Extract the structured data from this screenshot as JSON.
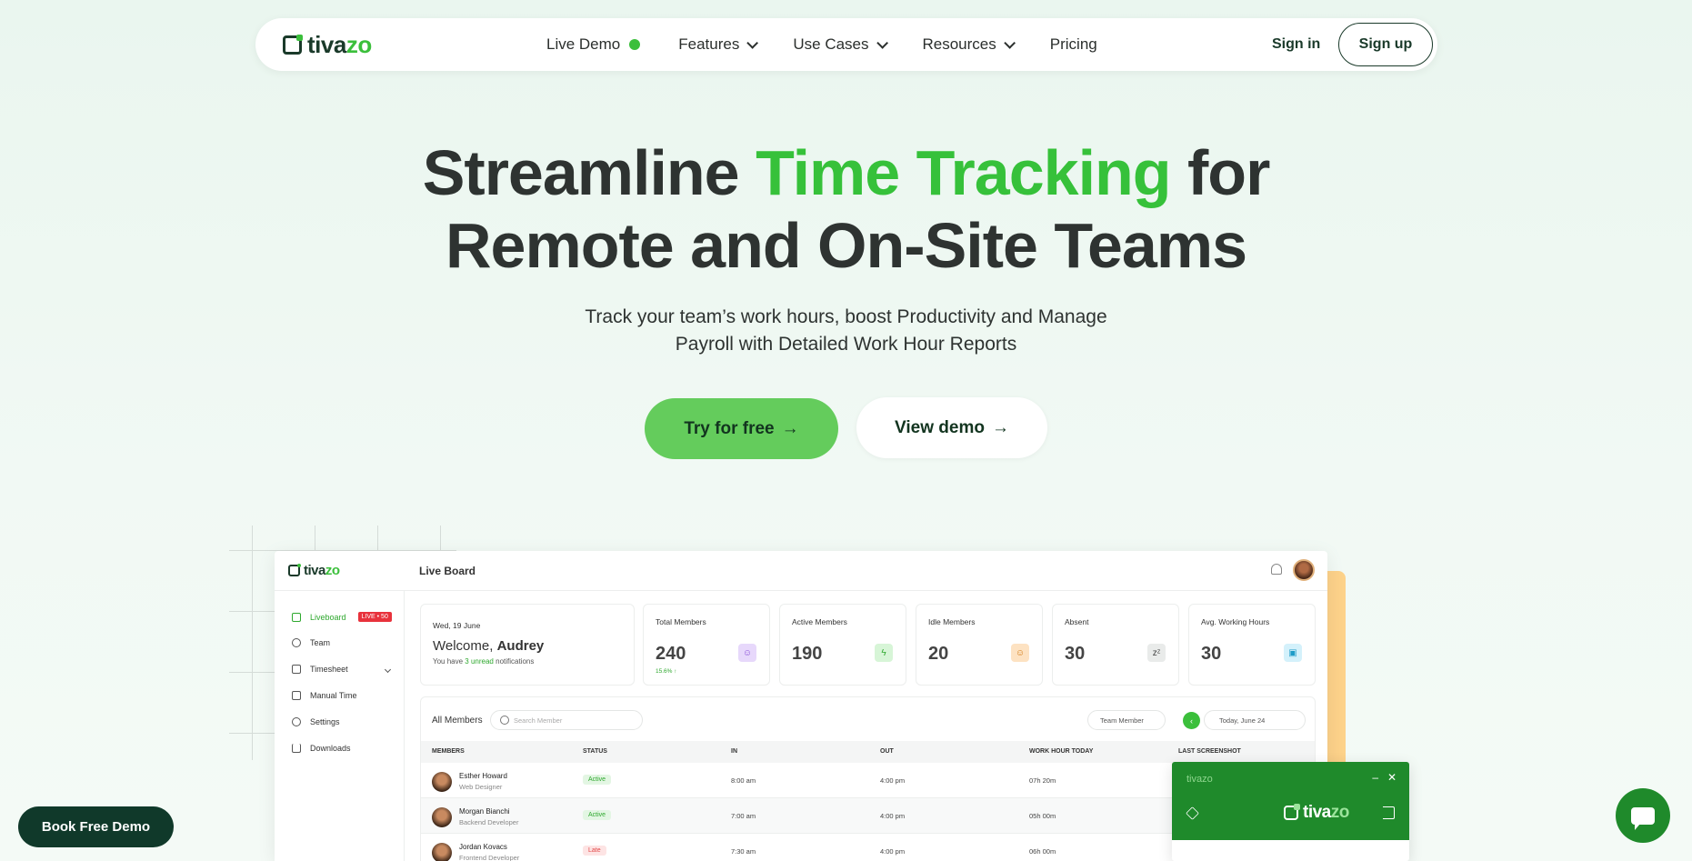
{
  "nav": {
    "brand_prefix": "tiva",
    "brand_suffix": "zo",
    "links": [
      {
        "label": "Live Demo"
      },
      {
        "label": "Features"
      },
      {
        "label": "Use Cases"
      },
      {
        "label": "Resources"
      },
      {
        "label": "Pricing"
      }
    ],
    "signin": "Sign in",
    "signup": "Sign up"
  },
  "hero": {
    "title_part1": "Streamline ",
    "title_accent": "Time Tracking",
    "title_part2": " for",
    "title_line2": "Remote and On-Site Teams",
    "subtitle_line1": "Track your team’s work hours, boost Productivity and Manage",
    "subtitle_line2": "Payroll with Detailed Work Hour Reports",
    "cta_primary": "Try for free",
    "cta_secondary": "View demo",
    "arrow": "→"
  },
  "dashboard": {
    "brand_prefix": "tiva",
    "brand_suffix": "zo",
    "page_title": "Live Board",
    "sidebar": [
      {
        "label": "Liveboard",
        "badge": "LIVE • 50"
      },
      {
        "label": "Team"
      },
      {
        "label": "Timesheet"
      },
      {
        "label": "Manual Time"
      },
      {
        "label": "Settings"
      },
      {
        "label": "Downloads"
      }
    ],
    "welcome": {
      "date": "Wed, 19 June",
      "greeting": "Welcome, ",
      "name": "Audrey",
      "note_prefix": "You have ",
      "note_highlight": "3 unread",
      "note_suffix": " notifications"
    },
    "stats": [
      {
        "label": "Total Members",
        "value": "240",
        "delta": "15.6% ↑",
        "icon": "users-icon",
        "color": "#e7d8fb"
      },
      {
        "label": "Active Members",
        "value": "190",
        "icon": "bolt-icon",
        "color": "#d7f5d7"
      },
      {
        "label": "Idle Members",
        "value": "20",
        "icon": "smile-icon",
        "color": "#fde2c2"
      },
      {
        "label": "Absent",
        "value": "30",
        "icon": "sleep-icon",
        "color": "#e9ebea"
      },
      {
        "label": "Avg. Working Hours",
        "value": "30",
        "icon": "briefcase-icon",
        "color": "#d4f1fb"
      }
    ],
    "table": {
      "title": "All Members",
      "search_placeholder": "Search Member",
      "filter": "Team Member",
      "date": "Today, June 24",
      "columns": [
        "MEMBERS",
        "STATUS",
        "IN",
        "OUT",
        "WORK HOUR TODAY",
        "LAST SCREENSHOT"
      ],
      "rows": [
        {
          "name": "Esther Howard",
          "role": "Web Designer",
          "status": "Active",
          "in": "8:00 am",
          "out": "4:00 pm",
          "hours": "07h 20m"
        },
        {
          "name": "Morgan Bianchi",
          "role": "Backend Developer",
          "status": "Active",
          "in": "7:00 am",
          "out": "4:00 pm",
          "hours": "05h 00m"
        },
        {
          "name": "Jordan Kovacs",
          "role": "Frontend Developer",
          "status": "Late",
          "in": "7:30 am",
          "out": "4:00 pm",
          "hours": "06h 00m"
        }
      ]
    },
    "tray": {
      "name": "tivazo",
      "minimize": "–",
      "close": "✕"
    }
  },
  "floating": {
    "book_demo": "Book Free Demo"
  }
}
